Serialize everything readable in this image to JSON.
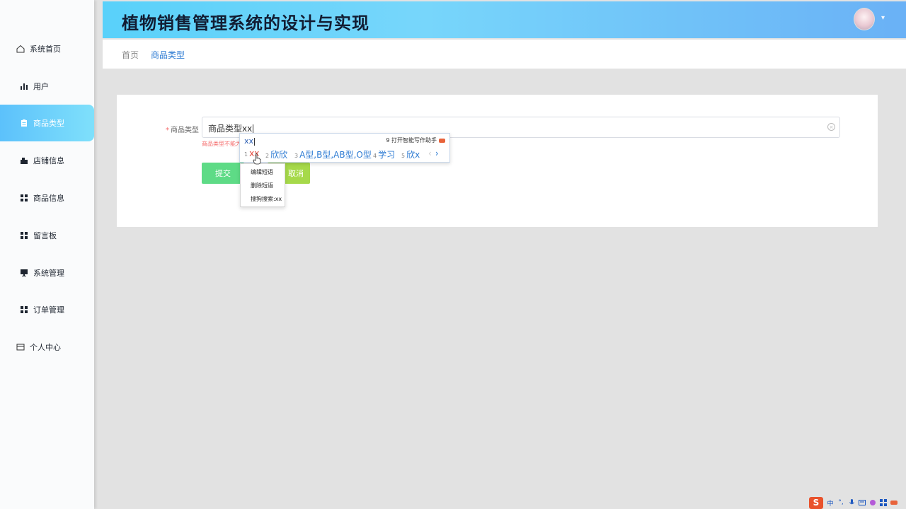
{
  "app": {
    "title": "植物销售管理系统的设计与实现"
  },
  "sidebar": {
    "items": [
      {
        "label": "系统首页",
        "icon": "home-icon"
      },
      {
        "label": "用户",
        "icon": "bar-chart-icon"
      },
      {
        "label": "商品类型",
        "icon": "clipboard-icon",
        "active": true
      },
      {
        "label": "店铺信息",
        "icon": "store-icon"
      },
      {
        "label": "商品信息",
        "icon": "grid-icon"
      },
      {
        "label": "留言板",
        "icon": "grid-icon"
      },
      {
        "label": "系统管理",
        "icon": "monitor-icon"
      },
      {
        "label": "订单管理",
        "icon": "grid-icon"
      },
      {
        "label": "个人中心",
        "icon": "id-card-icon"
      }
    ]
  },
  "header": {
    "user_menu_caret": "▾"
  },
  "breadcrumb": {
    "home": "首页",
    "current": "商品类型"
  },
  "form": {
    "label": "商品类型",
    "required_mark": "*",
    "value": "商品类型xx",
    "error": "商品类型不能为空",
    "submit_label": "提交",
    "cancel_label": "取消"
  },
  "ime": {
    "typed": "xx",
    "assistant": "9 打开智能写作助手",
    "candidates": [
      {
        "num": "1",
        "text": "xx"
      },
      {
        "num": "2",
        "text": "欣欣"
      },
      {
        "num": "3",
        "text": "A型,B型,AB型,O型"
      },
      {
        "num": "4",
        "text": "学习"
      },
      {
        "num": "5",
        "text": "欣x"
      }
    ],
    "prev": "‹",
    "next": "›",
    "context_menu": [
      "编辑短语",
      "删除短语",
      "搜狗搜索:xx"
    ]
  },
  "tray": {
    "ime_logo": "S",
    "lang": "中"
  },
  "colors": {
    "header_gradient_start": "#59d1fa",
    "header_gradient_end": "#6ab1f6",
    "active_item": "#5cc1fb",
    "submit": "#5edb86",
    "cancel": "#a6d94a",
    "error": "#f56c6c",
    "link": "#2d7bd3"
  }
}
